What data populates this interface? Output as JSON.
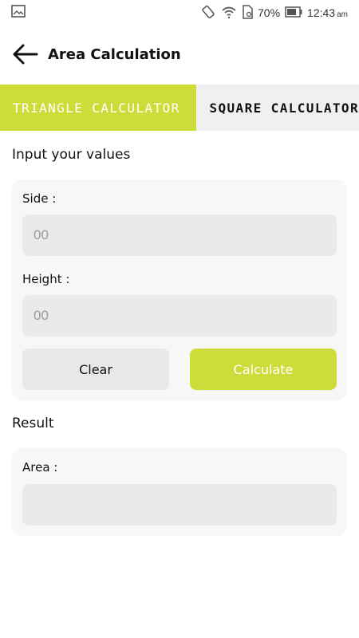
{
  "status_bar": {
    "battery_percent": "70%",
    "time": "12:43",
    "ampm": "am"
  },
  "app_bar": {
    "title": "Area Calculation"
  },
  "tabs": [
    {
      "label": "TRIANGLE CALCULATOR",
      "active": true
    },
    {
      "label": "SQUARE CALCULATOR",
      "active": false
    }
  ],
  "input_section": {
    "title": "Input your values",
    "side_label": "Side :",
    "side_placeholder": "00",
    "height_label": "Height :",
    "height_placeholder": "00",
    "clear_label": "Clear",
    "calculate_label": "Calculate"
  },
  "result_section": {
    "title": "Result",
    "area_label": "Area :",
    "area_value": ""
  },
  "colors": {
    "accent": "#cddc39"
  }
}
